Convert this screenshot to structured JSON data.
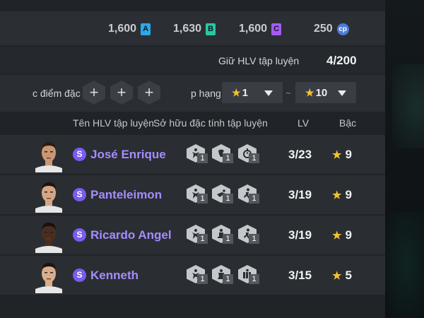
{
  "currencies": [
    {
      "value": "1,600",
      "badge": "A",
      "color": "#2aa8e8",
      "icon": "currency-a-icon"
    },
    {
      "value": "1,630",
      "badge": "B",
      "color": "#29c7a0",
      "icon": "currency-b-icon"
    },
    {
      "value": "1,600",
      "badge": "C",
      "color": "#a35cf0",
      "icon": "currency-c-icon"
    },
    {
      "value": "250",
      "badge": "cp",
      "color": "#4c7bd9",
      "icon": "coin-icon"
    }
  ],
  "keep": {
    "label": "Giữ HLV tập luyện",
    "count": "4/200"
  },
  "filter": {
    "points_label": "c điểm đặc",
    "add_symbol": "+",
    "rank_label": "p hạng",
    "rank_from": "1",
    "rank_to": "10",
    "separator": "~"
  },
  "headers": {
    "name": "Tên HLV tập luyện",
    "traits": "Sở hữu đặc tính tập luyện",
    "lv": "LV",
    "grade": "Bậc"
  },
  "coaches": [
    {
      "badge": "S",
      "name": "José Enrique",
      "traits": [
        {
          "icon": "trait-shot-icon",
          "level": "1"
        },
        {
          "icon": "trait-dribble-icon",
          "level": "1"
        },
        {
          "icon": "trait-stopwatch-icon",
          "level": "1"
        }
      ],
      "lv": "3/23",
      "grade": "9",
      "skin": "#c99773",
      "hair": "#2a1c14"
    },
    {
      "badge": "S",
      "name": "Panteleimon",
      "traits": [
        {
          "icon": "trait-shot-icon",
          "level": "1"
        },
        {
          "icon": "trait-tackle-icon",
          "level": "1"
        },
        {
          "icon": "trait-run-icon",
          "level": "1"
        }
      ],
      "lv": "3/19",
      "grade": "9",
      "skin": "#d6a684",
      "hair": "#1b1512"
    },
    {
      "badge": "S",
      "name": "Ricardo Angel",
      "traits": [
        {
          "icon": "trait-shot-icon",
          "level": "1"
        },
        {
          "icon": "trait-header-icon",
          "level": "1"
        },
        {
          "icon": "trait-run-icon",
          "level": "1"
        }
      ],
      "lv": "3/19",
      "grade": "9",
      "skin": "#4a2d1f",
      "hair": "#1a100b"
    },
    {
      "badge": "S",
      "name": "Kenneth",
      "traits": [
        {
          "icon": "trait-shot-icon",
          "level": "1"
        },
        {
          "icon": "trait-keeper-icon",
          "level": "1"
        },
        {
          "icon": "trait-wall-icon",
          "level": "1"
        }
      ],
      "lv": "3/15",
      "grade": "5",
      "skin": "#d9ad8a",
      "hair": "#1c1410"
    }
  ]
}
